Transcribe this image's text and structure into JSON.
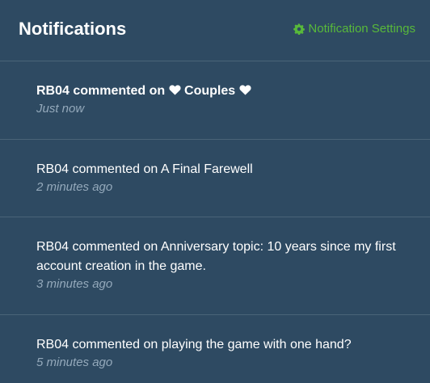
{
  "header": {
    "title": "Notifications",
    "settings_label": "Notification Settings"
  },
  "colors": {
    "background": "#2e4a62",
    "accent": "#58b93a",
    "divider": "#4a6478",
    "timestamp": "#94a9bb"
  },
  "notifications": [
    {
      "text_prefix": "RB04 commented on ",
      "topic": "Couples",
      "topic_decoration": "heart-icon",
      "time": "Just now",
      "unread": true
    },
    {
      "text": "RB04 commented on A Final Farewell",
      "time": "2 minutes ago",
      "unread": false
    },
    {
      "text": "RB04 commented on Anniversary topic: 10 years since my first account creation in the game.",
      "time": "3 minutes ago",
      "unread": false
    },
    {
      "text": "RB04 commented on playing the game with one hand?",
      "time": "5 minutes ago",
      "unread": false
    }
  ]
}
